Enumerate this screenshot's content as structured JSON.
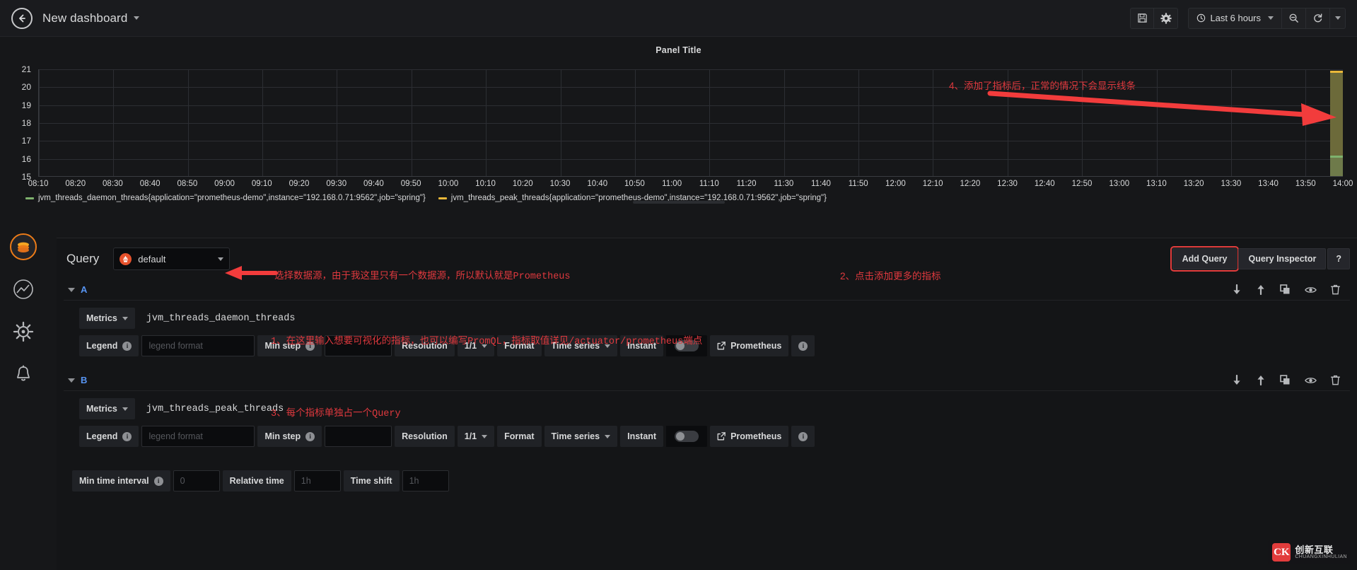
{
  "topnav": {
    "back_icon": "arrow-left-icon",
    "title": "New dashboard",
    "dropdown_caret": "chevron-down-icon",
    "save_icon": "save-disk-icon",
    "settings_icon": "gear-icon",
    "time_range": "Last 6 hours",
    "time_icon": "clock-icon",
    "zoom_out_icon": "zoom-out-icon",
    "refresh_icon": "refresh-icon",
    "refresh_caret_icon": "chevron-down-icon"
  },
  "panel": {
    "title": "Panel Title",
    "legend": [
      {
        "color": "#7eb26d",
        "text": "jvm_threads_daemon_threads{application=\"prometheus-demo\",instance=\"192.168.0.71:9562\",job=\"spring\"}"
      },
      {
        "color": "#eab839",
        "text": "jvm_threads_peak_threads{application=\"prometheus-demo\",instance=\"192.168.0.71:9562\",job=\"spring\"}"
      }
    ]
  },
  "chart_data": {
    "type": "line",
    "title": "Panel Title",
    "xlabel": "",
    "ylabel": "",
    "ylim": [
      15,
      21
    ],
    "yticks": [
      15,
      16,
      17,
      18,
      19,
      20,
      21
    ],
    "xticks": [
      "08:10",
      "08:20",
      "08:30",
      "08:40",
      "08:50",
      "09:00",
      "09:10",
      "09:20",
      "09:30",
      "09:40",
      "09:50",
      "10:00",
      "10:10",
      "10:20",
      "10:30",
      "10:40",
      "10:50",
      "11:00",
      "11:10",
      "11:20",
      "11:30",
      "11:40",
      "11:50",
      "12:00",
      "12:10",
      "12:20",
      "12:30",
      "12:40",
      "12:50",
      "13:00",
      "13:10",
      "13:20",
      "13:30",
      "13:40",
      "13:50",
      "14:00"
    ],
    "grid": true,
    "legend_position": "bottom",
    "note": "Data present only at far-right edge of time window; series render as narrow vertical bands near 14:00.",
    "series": [
      {
        "name": "jvm_threads_daemon_threads{application=\"prometheus-demo\",instance=\"192.168.0.71:9562\",job=\"spring\"}",
        "color": "#7eb26d",
        "x": [
          "14:00"
        ],
        "values": [
          16
        ]
      },
      {
        "name": "jvm_threads_peak_threads{application=\"prometheus-demo\",instance=\"192.168.0.71:9562\",job=\"spring\"}",
        "color": "#eab839",
        "x": [
          "14:00"
        ],
        "values": [
          20.5
        ]
      }
    ]
  },
  "sidebar": {
    "items": [
      {
        "name": "grafana-logo-icon",
        "label": ""
      },
      {
        "name": "dashboards-icon",
        "label": ""
      },
      {
        "name": "explore-compass-icon",
        "label": ""
      },
      {
        "name": "alerting-bell-icon",
        "label": ""
      }
    ]
  },
  "editor": {
    "query_label": "Query",
    "datasource": {
      "value": "default",
      "icon": "prometheus-logo-icon",
      "caret": "chevron-down-icon"
    },
    "add_query_label": "Add Query",
    "query_inspector_label": "Query Inspector",
    "help_label": "?",
    "rows": [
      {
        "ref": "A",
        "metrics_label": "Metrics",
        "metric_value": "jvm_threads_daemon_threads",
        "legend_label": "Legend",
        "legend_placeholder": "legend format",
        "legend_value": "",
        "min_step_label": "Min step",
        "min_step_value": "",
        "resolution_label": "Resolution",
        "resolution_value": "1/1",
        "format_label": "Format",
        "format_value": "Time series",
        "instant_label": "Instant",
        "instant_on": false,
        "link_label": "Prometheus",
        "icons": [
          "arrow-down-icon",
          "arrow-up-icon",
          "duplicate-icon",
          "eye-icon",
          "trash-icon"
        ]
      },
      {
        "ref": "B",
        "metrics_label": "Metrics",
        "metric_value": "jvm_threads_peak_threads",
        "legend_label": "Legend",
        "legend_placeholder": "legend format",
        "legend_value": "",
        "min_step_label": "Min step",
        "min_step_value": "",
        "resolution_label": "Resolution",
        "resolution_value": "1/1",
        "format_label": "Format",
        "format_value": "Time series",
        "instant_label": "Instant",
        "instant_on": false,
        "link_label": "Prometheus",
        "icons": [
          "arrow-down-icon",
          "arrow-up-icon",
          "duplicate-icon",
          "eye-icon",
          "trash-icon"
        ]
      }
    ],
    "options": {
      "min_time_interval_label": "Min time interval",
      "min_time_interval_placeholder": "0",
      "relative_time_label": "Relative time",
      "relative_time_placeholder": "1h",
      "time_shift_label": "Time shift",
      "time_shift_placeholder": "1h"
    }
  },
  "annotations": {
    "note4": "4、添加了指标后，正常的情况下会显示线条",
    "note_datasource": "选择数据源，由于我这里只有一个数据源，所以默认就是Prometheus",
    "note2": "2、点击添加更多的指标",
    "note1": "1、在这里输入想要可视化的指标，也可以编写PromQL，指标取值详见/actuator/prometheus端点",
    "note3": "3、每个指标单独占一个Query",
    "color": "#e0393e"
  },
  "watermark": {
    "mark": "CK",
    "cn": "创新互联",
    "en": "CHUANGXINHULIAN"
  }
}
